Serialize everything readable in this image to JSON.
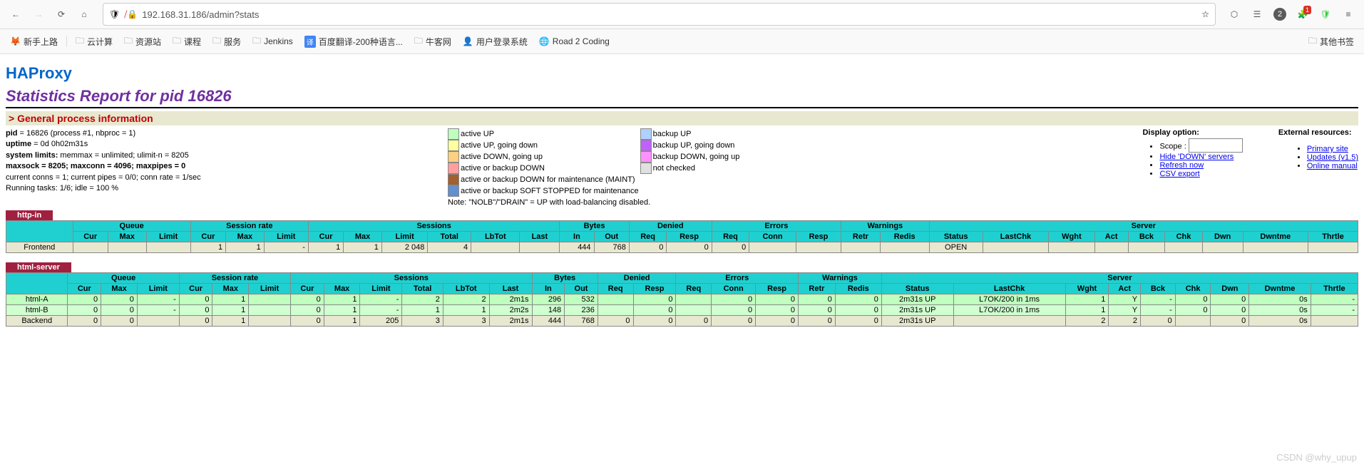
{
  "browser": {
    "url": "192.168.31.186/admin?stats",
    "bookmarks": [
      {
        "label": "新手上路",
        "icon": "firefox"
      },
      {
        "label": "云计算",
        "icon": "folder"
      },
      {
        "label": "资源站",
        "icon": "folder"
      },
      {
        "label": "课程",
        "icon": "folder"
      },
      {
        "label": "服务",
        "icon": "folder"
      },
      {
        "label": "Jenkins",
        "icon": "folder"
      },
      {
        "label": "百度翻译-200种语言...",
        "icon": "translate"
      },
      {
        "label": "牛客网",
        "icon": "folder"
      },
      {
        "label": "用户登录系统",
        "icon": "user"
      },
      {
        "label": "Road 2 Coding",
        "icon": "globe"
      }
    ],
    "other_bookmarks": "其他书签",
    "ext_badge": "1",
    "counter_badge": "2"
  },
  "page": {
    "title": "HAProxy",
    "subtitle": "Statistics Report for pid 16826",
    "section": "> General process information",
    "sysinfo": {
      "pid_label": "pid",
      "pid_value": " = 16826 (process #1, nbproc = 1)",
      "uptime_label": "uptime",
      "uptime_value": " = 0d 0h02m31s",
      "syslimits_label": "system limits:",
      "syslimits_value": " memmax = unlimited; ulimit-n = 8205",
      "maxsock_line": "maxsock = 8205; maxconn = 4096; maxpipes = 0",
      "conns_line": "current conns = 1; current pipes = 0/0; conn rate = 1/sec",
      "tasks_line": "Running tasks: 1/6;  idle = 100 %"
    },
    "legend": {
      "left": [
        {
          "color": "#c0ffc0",
          "label": "active UP"
        },
        {
          "color": "#ffffa0",
          "label": "active UP, going down"
        },
        {
          "color": "#ffd080",
          "label": "active DOWN, going up"
        },
        {
          "color": "#ffa0a0",
          "label": "active or backup DOWN"
        },
        {
          "color": "#a06030",
          "label": "active or backup DOWN for maintenance (MAINT)"
        },
        {
          "color": "#6090d0",
          "label": "active or backup SOFT STOPPED for maintenance"
        }
      ],
      "right": [
        {
          "color": "#b0d0ff",
          "label": "backup UP"
        },
        {
          "color": "#c060ff",
          "label": "backup UP, going down"
        },
        {
          "color": "#ff90ff",
          "label": "backup DOWN, going up"
        },
        {
          "color": "#e0e0e0",
          "label": "not checked"
        }
      ],
      "note": "Note: \"NOLB\"/\"DRAIN\" = UP with load-balancing disabled."
    },
    "display_option": {
      "title": "Display option:",
      "scope_label": "Scope :",
      "links": [
        "Hide 'DOWN' servers",
        "Refresh now",
        "CSV export"
      ]
    },
    "external": {
      "title": "External resources:",
      "links": [
        "Primary site",
        "Updates (v1.5)",
        "Online manual"
      ]
    },
    "headers": {
      "groups": [
        "Queue",
        "Session rate",
        "Sessions",
        "Bytes",
        "Denied",
        "Errors",
        "Warnings",
        "Server"
      ],
      "queue": [
        "Cur",
        "Max",
        "Limit"
      ],
      "srate": [
        "Cur",
        "Max",
        "Limit"
      ],
      "sessions": [
        "Cur",
        "Max",
        "Limit",
        "Total",
        "LbTot",
        "Last"
      ],
      "bytes": [
        "In",
        "Out"
      ],
      "denied": [
        "Req",
        "Resp"
      ],
      "errors": [
        "Req",
        "Conn",
        "Resp"
      ],
      "warnings": [
        "Retr",
        "Redis"
      ],
      "server": [
        "Status",
        "LastChk",
        "Wght",
        "Act",
        "Bck",
        "Chk",
        "Dwn",
        "Dwntme",
        "Thrtle"
      ]
    },
    "proxies": [
      {
        "name": "http-in",
        "rows": [
          {
            "class": "frontend",
            "name": "Frontend",
            "cells": [
              "",
              "",
              "",
              "1",
              "1",
              "-",
              "1",
              "1",
              "2 048",
              "4",
              "",
              "",
              "444",
              "768",
              "0",
              "0",
              "0",
              "",
              "",
              "",
              "",
              "OPEN",
              "",
              "",
              "",
              "",
              "",
              "",
              "",
              ""
            ]
          }
        ]
      },
      {
        "name": "html-server",
        "rows": [
          {
            "class": "server-a",
            "name": "html-A",
            "cells": [
              "0",
              "0",
              "-",
              "0",
              "1",
              "",
              "0",
              "1",
              "-",
              "2",
              "2",
              "2m1s",
              "296",
              "532",
              "",
              "0",
              "",
              "0",
              "0",
              "0",
              "0",
              "2m31s UP",
              "L7OK/200 in 1ms",
              "1",
              "Y",
              "-",
              "0",
              "0",
              "0s",
              "-"
            ]
          },
          {
            "class": "server-b",
            "name": "html-B",
            "cells": [
              "0",
              "0",
              "-",
              "0",
              "1",
              "",
              "0",
              "1",
              "-",
              "1",
              "1",
              "2m2s",
              "148",
              "236",
              "",
              "0",
              "",
              "0",
              "0",
              "0",
              "0",
              "2m31s UP",
              "L7OK/200 in 1ms",
              "1",
              "Y",
              "-",
              "0",
              "0",
              "0s",
              "-"
            ]
          },
          {
            "class": "backend",
            "name": "Backend",
            "cells": [
              "0",
              "0",
              "",
              "0",
              "1",
              "",
              "0",
              "1",
              "205",
              "3",
              "3",
              "2m1s",
              "444",
              "768",
              "0",
              "0",
              "0",
              "0",
              "0",
              "0",
              "0",
              "2m31s UP",
              "",
              "2",
              "2",
              "0",
              "",
              "0",
              "0s",
              ""
            ]
          }
        ]
      }
    ]
  },
  "watermark": "CSDN @why_upup"
}
